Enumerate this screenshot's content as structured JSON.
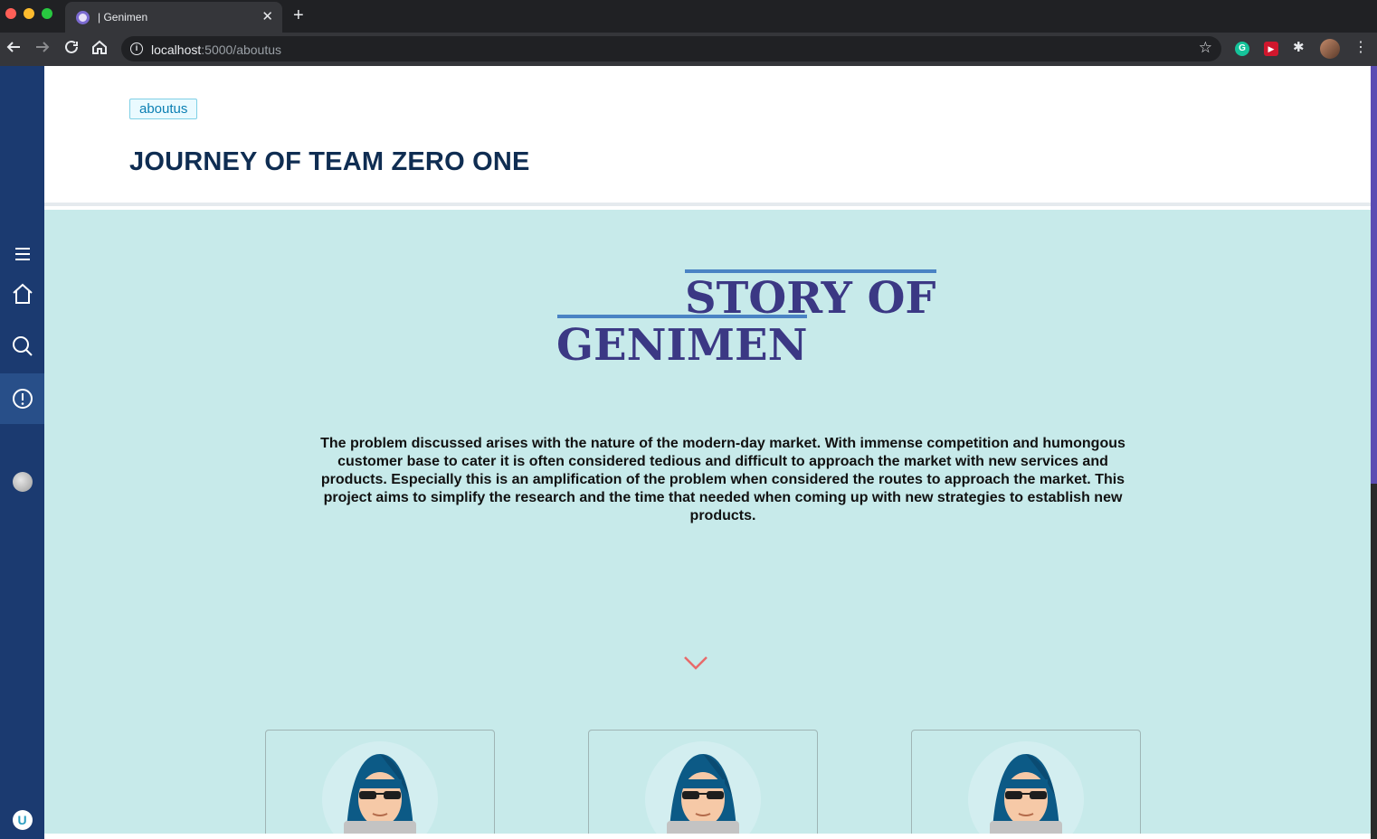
{
  "browser": {
    "tab_title": "| Genimen",
    "tab_close": "✕",
    "new_tab": "+",
    "url_host": "localhost",
    "url_path": ":5000/aboutus",
    "extension_grammarly": "G"
  },
  "page": {
    "breadcrumb": "aboutus",
    "title": "JOURNEY OF TEAM ZERO ONE"
  },
  "hero": {
    "story_title_line1": "STORY OF",
    "story_title_line2": "GENIMEN",
    "story_text": "The problem discussed arises with the nature of the modern-day market. With immense competition and humongous customer base to cater it is often considered tedious and difficult to approach the market with new services and products. Especially this is an amplification of the problem when considered the routes to approach the market. This project aims to simplify the research and the time that needed when coming up with new strategies to establish new products."
  },
  "sidebar": {
    "items": [
      {
        "icon": "menu-icon"
      },
      {
        "icon": "home-icon"
      },
      {
        "icon": "search-icon"
      },
      {
        "icon": "alert-circle-icon",
        "active": true
      },
      {
        "icon": "moon-icon"
      },
      {
        "icon": "logo-icon"
      }
    ],
    "logo_text": "U"
  },
  "team_cards": [
    {
      "avatar": "hacker-avatar"
    },
    {
      "avatar": "hacker-avatar"
    },
    {
      "avatar": "hacker-avatar"
    }
  ],
  "colors": {
    "sidebar": "#1b3a70",
    "hero_bg": "#c7eaea",
    "story_title": "#3b3884",
    "title": "#0f2d52",
    "chevron": "#e86a6a"
  }
}
